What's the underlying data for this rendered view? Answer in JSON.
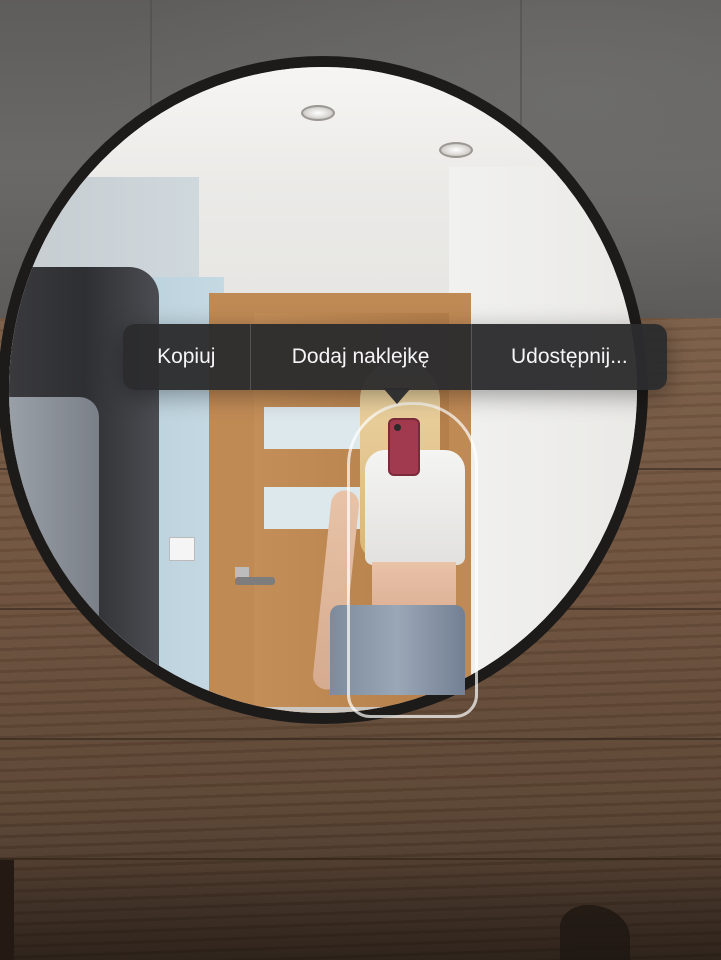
{
  "context_menu": {
    "items": [
      {
        "label": "Kopiuj"
      },
      {
        "label": "Dodaj naklejkę"
      },
      {
        "label": "Udostępnij..."
      }
    ],
    "background_color": "#2c2c2e",
    "text_color": "#f5f5f7"
  },
  "photo": {
    "subject_phone_color": "#a23a4f",
    "mirror_frame_color": "#1d1b1a"
  }
}
